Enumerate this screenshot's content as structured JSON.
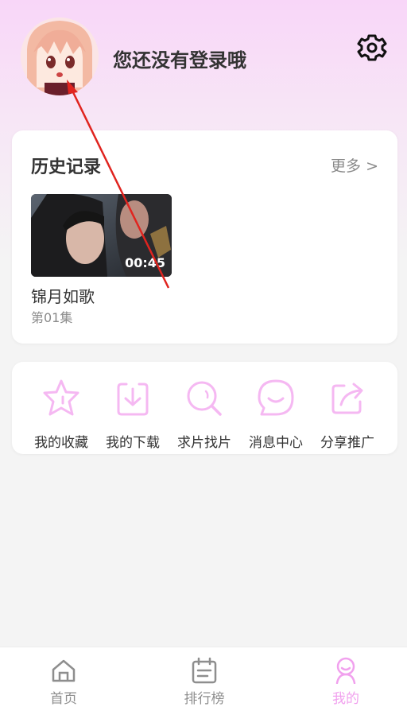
{
  "header": {
    "login_prompt": "您还没有登录哦",
    "settings_icon": "gear-icon",
    "avatar_icon": "anime-avatar"
  },
  "history": {
    "title": "历史记录",
    "more_label": "更多 >",
    "items": [
      {
        "title": "锦月如歌",
        "episode": "第01集",
        "duration": "00:45"
      }
    ]
  },
  "actions": [
    {
      "label": "我的收藏",
      "icon": "star-icon"
    },
    {
      "label": "我的下载",
      "icon": "download-icon"
    },
    {
      "label": "求片找片",
      "icon": "search-icon"
    },
    {
      "label": "消息中心",
      "icon": "chat-icon"
    },
    {
      "label": "分享推广",
      "icon": "share-icon"
    }
  ],
  "tabbar": {
    "items": [
      {
        "label": "首页",
        "icon": "home-icon",
        "active": false
      },
      {
        "label": "排行榜",
        "icon": "calendar-icon",
        "active": false
      },
      {
        "label": "我的",
        "icon": "user-icon",
        "active": true
      }
    ]
  },
  "colors": {
    "accent": "#f1a1ee",
    "icon_pink": "#f5b8f2",
    "arrow": "#e0241f"
  }
}
